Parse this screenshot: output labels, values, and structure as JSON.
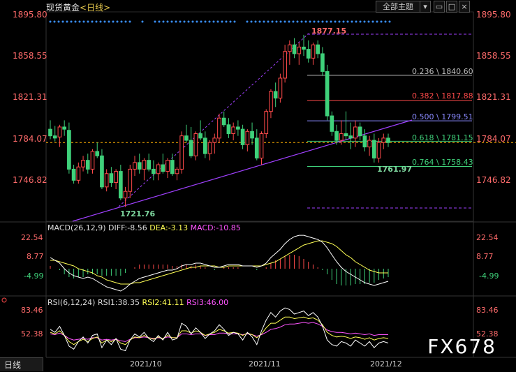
{
  "header": {
    "title": "现货黄金",
    "period": "<日线>",
    "overview_button": "全部主题",
    "dropdown_icon": "chevron-down-icon",
    "window_buttons": [
      "restore-icon",
      "maximize-icon",
      "close-icon"
    ]
  },
  "colors": {
    "up": "#ff4a4a",
    "down": "#3fd17a",
    "fib_023": "#bdbdbd",
    "fib_038": "#ff4a4a",
    "fib_050": "#8a8aff",
    "fib_061": "#3fd17a",
    "fib_076": "#3fd17a",
    "trend": "#a040ff",
    "price_line": "#ffb000",
    "macd_diff": "#ffffff",
    "macd_dea": "#ffff55",
    "macd_macd": "#ff55ff",
    "rsi1": "#ffffff",
    "rsi2": "#ffff55",
    "rsi3": "#ff55ff"
  },
  "price_axis": {
    "ticks": [
      "1895.80",
      "1858.55",
      "1821.31",
      "1784.07",
      "1746.82"
    ]
  },
  "fib_levels": [
    {
      "label": "0.236 \\ 1840.60",
      "value": 1840.6,
      "color": "#bdbdbd"
    },
    {
      "label": "0.382 \\ 1817.88",
      "value": 1817.88,
      "color": "#ff4a4a"
    },
    {
      "label": "0.500 \\ 1799.51",
      "value": 1799.51,
      "color": "#8a8aff"
    },
    {
      "label": "0.618 \\ 1781.15",
      "value": 1781.15,
      "color": "#3fd17a"
    },
    {
      "label": "0.764 \\ 1758.43",
      "value": 1758.43,
      "color": "#3fd17a"
    }
  ],
  "annotations": {
    "high": "1877.15",
    "low": "1721.76",
    "recent_low": "1761.97"
  },
  "macd": {
    "title": "MACD(26,12,9)",
    "diff_label": "DIFF:-8.56",
    "dea_label": "DEA:-3.13",
    "macd_label": "MACD:-10.85",
    "ticks": [
      "22.54",
      "8.77",
      "-4.99"
    ]
  },
  "rsi": {
    "title": "RSI(6,12,24)",
    "rsi1_label": "RSI1:38.35",
    "rsi2_label": "RSI2:41.11",
    "rsi3_label": "RSI3:46.00",
    "ticks": [
      "83.46",
      "52.38"
    ]
  },
  "x_axis": {
    "labels": [
      "2021/10",
      "2021/11",
      "2021/12"
    ]
  },
  "footer": {
    "tab_label": "日线"
  },
  "watermark": "FX678",
  "chart_data": {
    "type": "candlestick",
    "title": "现货黄金 <日线>",
    "ylim": [
      1722,
      1896
    ],
    "candles": [
      [
        1792,
        1800,
        1783,
        1786
      ],
      [
        1786,
        1795,
        1781,
        1784
      ],
      [
        1785,
        1796,
        1776,
        1794
      ],
      [
        1794,
        1800,
        1786,
        1792
      ],
      [
        1791,
        1798,
        1752,
        1756
      ],
      [
        1756,
        1760,
        1743,
        1746
      ],
      [
        1746,
        1762,
        1743,
        1758
      ],
      [
        1758,
        1768,
        1754,
        1764
      ],
      [
        1764,
        1770,
        1752,
        1756
      ],
      [
        1756,
        1774,
        1752,
        1772
      ],
      [
        1772,
        1780,
        1766,
        1768
      ],
      [
        1768,
        1774,
        1738,
        1740
      ],
      [
        1740,
        1756,
        1736,
        1752
      ],
      [
        1752,
        1758,
        1740,
        1744
      ],
      [
        1744,
        1756,
        1738,
        1754
      ],
      [
        1754,
        1760,
        1728,
        1730
      ],
      [
        1730,
        1740,
        1722,
        1736
      ],
      [
        1736,
        1760,
        1730,
        1756
      ],
      [
        1756,
        1768,
        1750,
        1762
      ],
      [
        1762,
        1770,
        1752,
        1756
      ],
      [
        1756,
        1766,
        1746,
        1764
      ],
      [
        1764,
        1770,
        1754,
        1756
      ],
      [
        1756,
        1764,
        1746,
        1752
      ],
      [
        1752,
        1762,
        1746,
        1760
      ],
      [
        1760,
        1770,
        1752,
        1754
      ],
      [
        1754,
        1766,
        1748,
        1764
      ],
      [
        1764,
        1770,
        1750,
        1752
      ],
      [
        1752,
        1758,
        1746,
        1756
      ],
      [
        1756,
        1790,
        1752,
        1786
      ],
      [
        1786,
        1796,
        1780,
        1782
      ],
      [
        1782,
        1794,
        1766,
        1768
      ],
      [
        1768,
        1790,
        1764,
        1788
      ],
      [
        1788,
        1800,
        1782,
        1784
      ],
      [
        1784,
        1790,
        1766,
        1770
      ],
      [
        1770,
        1782,
        1764,
        1780
      ],
      [
        1780,
        1788,
        1770,
        1784
      ],
      [
        1784,
        1806,
        1780,
        1802
      ],
      [
        1802,
        1808,
        1794,
        1796
      ],
      [
        1796,
        1802,
        1784,
        1788
      ],
      [
        1788,
        1798,
        1782,
        1794
      ],
      [
        1794,
        1800,
        1786,
        1792
      ],
      [
        1792,
        1796,
        1774,
        1778
      ],
      [
        1778,
        1792,
        1772,
        1790
      ],
      [
        1790,
        1798,
        1778,
        1784
      ],
      [
        1784,
        1792,
        1764,
        1766
      ],
      [
        1766,
        1790,
        1760,
        1788
      ],
      [
        1788,
        1810,
        1784,
        1808
      ],
      [
        1808,
        1828,
        1802,
        1826
      ],
      [
        1826,
        1834,
        1812,
        1820
      ],
      [
        1820,
        1842,
        1816,
        1838
      ],
      [
        1838,
        1868,
        1834,
        1862
      ],
      [
        1862,
        1872,
        1850,
        1868
      ],
      [
        1868,
        1874,
        1856,
        1860
      ],
      [
        1860,
        1870,
        1850,
        1866
      ],
      [
        1866,
        1877,
        1858,
        1864
      ],
      [
        1864,
        1872,
        1852,
        1856
      ],
      [
        1856,
        1870,
        1850,
        1868
      ],
      [
        1868,
        1872,
        1856,
        1860
      ],
      [
        1860,
        1866,
        1840,
        1844
      ],
      [
        1844,
        1850,
        1800,
        1804
      ],
      [
        1804,
        1808,
        1786,
        1790
      ],
      [
        1790,
        1796,
        1778,
        1782
      ],
      [
        1782,
        1800,
        1778,
        1788
      ],
      [
        1788,
        1808,
        1782,
        1786
      ],
      [
        1786,
        1798,
        1774,
        1784
      ],
      [
        1784,
        1800,
        1776,
        1794
      ],
      [
        1794,
        1798,
        1782,
        1786
      ],
      [
        1786,
        1792,
        1772,
        1776
      ],
      [
        1776,
        1786,
        1768,
        1782
      ],
      [
        1782,
        1788,
        1762,
        1766
      ],
      [
        1766,
        1784,
        1762,
        1780
      ],
      [
        1780,
        1788,
        1774,
        1784
      ],
      [
        1784,
        1788,
        1776,
        1780
      ]
    ],
    "fib_levels": [
      1840.6,
      1817.88,
      1799.51,
      1781.15,
      1758.43
    ],
    "high": 1877.15,
    "low": 1721.76,
    "macd": {
      "ylim": [
        -18,
        30
      ],
      "diff": [
        8,
        6,
        4,
        0,
        -3,
        -5,
        -6,
        -7,
        -6,
        -7,
        -9,
        -11,
        -13,
        -14,
        -15,
        -16,
        -14,
        -11,
        -9,
        -7,
        -6,
        -5,
        -4,
        -3,
        -2,
        -1,
        -1,
        0,
        2,
        3,
        3,
        4,
        4,
        3,
        2,
        1,
        1,
        2,
        3,
        3,
        3,
        2,
        2,
        2,
        1,
        2,
        4,
        8,
        11,
        14,
        18,
        21,
        23,
        24,
        24,
        23,
        22,
        21,
        19,
        15,
        10,
        5,
        1,
        -2,
        -4,
        -6,
        -8,
        -10,
        -11,
        -12,
        -11,
        -10,
        -9
      ],
      "dea": [
        6,
        6,
        5,
        4,
        3,
        2,
        0,
        -1,
        -2,
        -3,
        -5,
        -6,
        -8,
        -9,
        -10,
        -11,
        -11,
        -11,
        -10,
        -10,
        -9,
        -8,
        -7,
        -6,
        -5,
        -4,
        -3,
        -2,
        -1,
        0,
        1,
        1,
        2,
        2,
        2,
        2,
        1,
        1,
        2,
        2,
        2,
        2,
        2,
        2,
        2,
        2,
        3,
        4,
        5,
        7,
        9,
        11,
        13,
        15,
        17,
        18,
        19,
        20,
        20,
        19,
        18,
        16,
        13,
        10,
        8,
        5,
        3,
        1,
        -1,
        -2,
        -3,
        -3,
        -3
      ],
      "hist": [
        2,
        0,
        -1,
        -4,
        -6,
        -7,
        -6,
        -6,
        -4,
        -4,
        -4,
        -5,
        -5,
        -5,
        -5,
        -5,
        -3,
        0,
        1,
        3,
        3,
        3,
        3,
        3,
        3,
        3,
        2,
        2,
        3,
        3,
        2,
        3,
        2,
        1,
        0,
        -1,
        0,
        1,
        1,
        1,
        1,
        0,
        0,
        0,
        -1,
        0,
        1,
        4,
        6,
        7,
        9,
        10,
        10,
        9,
        7,
        5,
        3,
        1,
        -1,
        -4,
        -8,
        -11,
        -12,
        -12,
        -12,
        -11,
        -11,
        -11,
        -10,
        -10,
        -8,
        -7,
        -6
      ]
    },
    "rsi": {
      "ylim": [
        30,
        90
      ],
      "rsi1": [
        58,
        54,
        62,
        50,
        36,
        32,
        42,
        48,
        40,
        50,
        52,
        34,
        44,
        38,
        46,
        32,
        30,
        44,
        52,
        48,
        54,
        46,
        42,
        50,
        44,
        54,
        44,
        46,
        66,
        62,
        52,
        60,
        54,
        46,
        52,
        56,
        64,
        58,
        50,
        54,
        52,
        44,
        54,
        48,
        38,
        56,
        70,
        80,
        74,
        82,
        86,
        84,
        78,
        80,
        82,
        76,
        80,
        74,
        62,
        44,
        38,
        36,
        42,
        40,
        36,
        44,
        40,
        36,
        42,
        34,
        40,
        42,
        40
      ],
      "rsi2": [
        54,
        52,
        56,
        50,
        42,
        38,
        42,
        45,
        42,
        46,
        48,
        40,
        44,
        42,
        45,
        40,
        38,
        44,
        48,
        47,
        50,
        47,
        45,
        48,
        46,
        50,
        47,
        47,
        56,
        56,
        53,
        56,
        54,
        50,
        52,
        54,
        58,
        56,
        53,
        54,
        53,
        50,
        53,
        51,
        47,
        52,
        60,
        66,
        66,
        70,
        74,
        74,
        72,
        73,
        74,
        72,
        73,
        70,
        64,
        54,
        50,
        48,
        49,
        48,
        46,
        48,
        47,
        45,
        47,
        44,
        46,
        47,
        46
      ],
      "rsi3": [
        52,
        51,
        53,
        50,
        46,
        44,
        45,
        46,
        45,
        47,
        47,
        44,
        45,
        44,
        45,
        43,
        42,
        45,
        47,
        47,
        48,
        47,
        46,
        47,
        46,
        48,
        47,
        47,
        52,
        52,
        51,
        52,
        52,
        50,
        51,
        51,
        53,
        53,
        52,
        52,
        52,
        51,
        52,
        51,
        49,
        51,
        54,
        58,
        59,
        61,
        64,
        65,
        65,
        66,
        67,
        66,
        67,
        65,
        62,
        57,
        55,
        54,
        54,
        53,
        52,
        53,
        52,
        51,
        52,
        50,
        51,
        51,
        51
      ]
    }
  }
}
